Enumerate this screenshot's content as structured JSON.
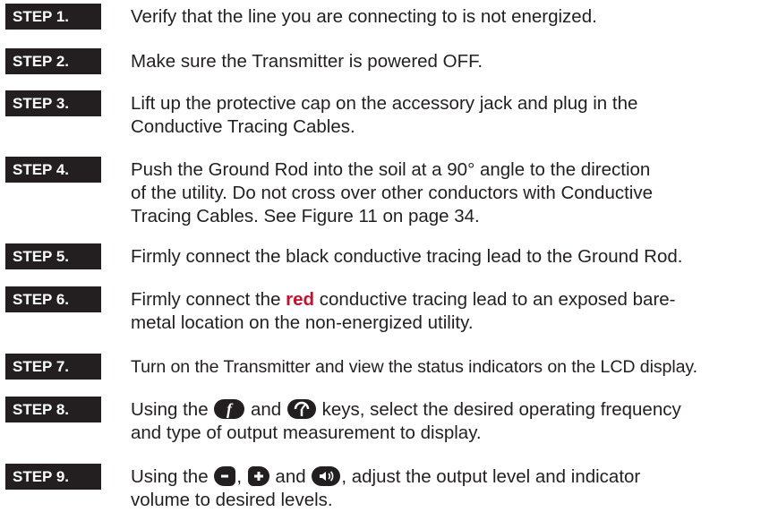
{
  "steps": [
    {
      "label": "STEP 1.",
      "text": "Verify that the line you are connecting to is not energized."
    },
    {
      "label": "STEP 2.",
      "text": "Make sure the Transmitter is powered OFF."
    },
    {
      "label": "STEP 3.",
      "line1": "Lift up the protective cap on the accessory jack and plug in the",
      "line2": "Conductive Tracing Cables."
    },
    {
      "label": "STEP 4.",
      "line1": "Push the Ground Rod into the soil at a 90° angle to the direction",
      "line2": "of the utility. Do not cross over other conductors with Conductive",
      "line3": "Tracing Cables. See Figure 11 on page 34."
    },
    {
      "label": "STEP 5.",
      "text": "Firmly connect the black conductive tracing lead to the Ground Rod."
    },
    {
      "label": "STEP 6.",
      "pre": "Firmly connect the ",
      "red": "red",
      "post": " conductive tracing lead to an exposed bare-",
      "line2": "metal location on the non-energized utility."
    },
    {
      "label": "STEP 7.",
      "text": "Turn on the Transmitter and view the status indicators on the LCD display."
    },
    {
      "label": "STEP 8.",
      "pre": "Using the ",
      "mid": " and ",
      "post": " keys, select the desired operating frequency",
      "line2": "and type of output measurement to display."
    },
    {
      "label": "STEP 9.",
      "pre": "Using the ",
      "sep": ", ",
      "mid": " and ",
      "post": ", adjust the output level and indicator",
      "line2": "volume to desired levels."
    }
  ],
  "icons": {
    "frequency_key": "frequency-key-icon",
    "measurement_key": "measurement-key-icon",
    "minus_key": "minus-key-icon",
    "plus_key": "plus-key-icon",
    "volume_key": "volume-key-icon"
  },
  "colors": {
    "badge": "#231f20",
    "text": "#231f20",
    "accent_red": "#c8102e"
  }
}
